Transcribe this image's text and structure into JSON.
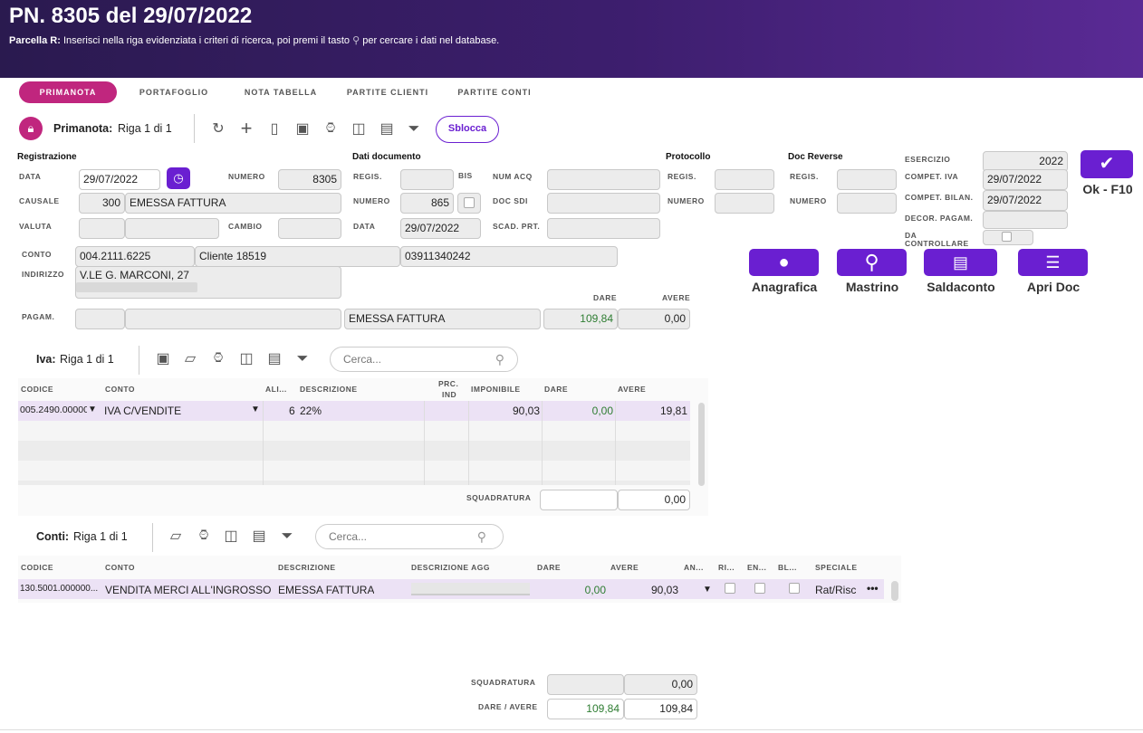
{
  "header": {
    "title": "PN. 8305 del 29/07/2022",
    "help_bold": "Parcella R:",
    "help_text": "Inserisci nella riga evidenziata i criteri di ricerca, poi premi il tasto",
    "help_icon": "search-icon",
    "help_text2": "per cercare i dati nel database."
  },
  "tabs": [
    "PRIMANOTA",
    "PORTAFOGLIO",
    "NOTA TABELLA",
    "PARTITE CLIENTI",
    "PARTITE CONTI"
  ],
  "toolbar": {
    "label": "Primanota:",
    "row": "Riga 1 di 1",
    "sblocca": "Sblocca"
  },
  "registrazione": {
    "title": "Registrazione",
    "data_lbl": "DATA",
    "data": "29/07/2022",
    "numero_lbl": "NUMERO",
    "numero": "8305",
    "causale_lbl": "CAUSALE",
    "causale_code": "300",
    "causale_desc": "EMESSA FATTURA",
    "valuta_lbl": "VALUTA",
    "cambio_lbl": "CAMBIO"
  },
  "documento": {
    "title": "Dati documento",
    "regis_lbl": "REGIS.",
    "bis_lbl": "BIS",
    "numacq_lbl": "NUM ACQ",
    "numero_lbl": "NUMERO",
    "numero": "865",
    "docsdi_lbl": "DOC SDI",
    "data_lbl": "DATA",
    "data": "29/07/2022",
    "scad_lbl": "SCAD. PRT."
  },
  "protocollo": {
    "title": "Protocollo",
    "regis_lbl": "REGIS.",
    "numero_lbl": "NUMERO"
  },
  "reverse": {
    "title": "Doc Reverse",
    "regis_lbl": "REGIS.",
    "numero_lbl": "NUMERO"
  },
  "esercizio": {
    "esercizio_lbl": "ESERCIZIO",
    "esercizio": "2022",
    "competiva_lbl": "COMPET. IVA",
    "competiva": "29/07/2022",
    "competbil_lbl": "COMPET. BILAN.",
    "competbil": "29/07/2022",
    "decor_lbl": "DECOR. PAGAM.",
    "dacontr_lbl": "DA CONTROLLARE"
  },
  "ok": {
    "label": "Ok - F10"
  },
  "conto": {
    "lbl": "CONTO",
    "code": "004.2111.6225",
    "name": "Cliente 18519",
    "piva": "03911340242",
    "indirizzo_lbl": "INDIRIZZO",
    "indirizzo": "V.LE G. MARCONI, 27",
    "pagam_lbl": "PAGAM.",
    "pagam_desc": "EMESSA FATTURA",
    "dare_lbl": "DARE",
    "avere_lbl": "AVERE",
    "dare": "109,84",
    "avere": "0,00"
  },
  "actions": [
    "Anagrafica",
    "Mastrino",
    "Saldaconto",
    "Apri Doc"
  ],
  "iva": {
    "label": "Iva:",
    "row": "Riga 1 di 1",
    "search": "Cerca...",
    "cols": [
      "CODICE",
      "CONTO",
      "ALI...",
      "DESCRIZIONE",
      "PRC.",
      "IND",
      "IMPONIBILE",
      "DARE",
      "AVERE"
    ],
    "row1": {
      "codice": "005.2490.00000",
      "conto": "IVA C/VENDITE",
      "ali": "6",
      "descr": "22%",
      "imponibile": "90,03",
      "dare": "0,00",
      "avere": "19,81"
    },
    "squad_lbl": "SQUADRATURA",
    "squad": "0,00"
  },
  "conti": {
    "label": "Conti:",
    "row": "Riga 1 di 1",
    "search": "Cerca...",
    "cols": [
      "CODICE",
      "CONTO",
      "DESCRIZIONE",
      "DESCRIZIONE AGG",
      "DARE",
      "AVERE",
      "AN...",
      "RI...",
      "EN...",
      "BL...",
      "SPECIALE"
    ],
    "row1": {
      "codice": "130.5001.000000...",
      "conto": "VENDITA MERCI ALL'INGROSSO",
      "descr": "EMESSA FATTURA",
      "dare": "0,00",
      "avere": "90,03",
      "speciale": "Rat/Risc",
      "more": "•••"
    }
  },
  "totals": {
    "squad_lbl": "SQUADRATURA",
    "squad": "0,00",
    "da_lbl": "DARE / AVERE",
    "dare": "109,84",
    "avere": "109,84"
  }
}
